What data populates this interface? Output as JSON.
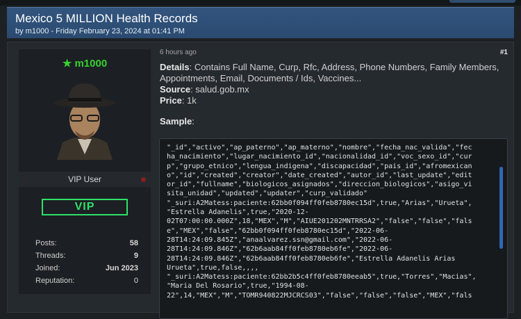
{
  "thread": {
    "title": "Mexico 5 MILLION Health Records",
    "byline": "by m1000 - Friday February 23, 2024 at 01:41 PM"
  },
  "author": {
    "username": "m1000",
    "role": "VIP User",
    "badge": "VIP",
    "stats": [
      {
        "label": "Posts:",
        "value": "58"
      },
      {
        "label": "Threads:",
        "value": "9"
      },
      {
        "label": "Joined:",
        "value": "Jun 2023"
      },
      {
        "label": "Reputation:",
        "value": "0"
      }
    ]
  },
  "post": {
    "time": "6 hours ago",
    "number": "#1",
    "details_label": "Details",
    "details_text": ": Contains Full Name, Curp, Rfc, Address, Phone Numbers, Family Members, Appointments, Email, Documents / Ids, Vaccines...",
    "source_label": "Source",
    "source_text": ": salud.gob.mx",
    "price_label": "Price",
    "price_text": ": 1k",
    "sample_label": "Sample",
    "sample_colon": ":",
    "code_lines": [
      "\"_id\",\"activo\",\"ap_paterno\",\"ap_materno\",\"nombre\",\"fecha_nac_valida\",\"fec",
      "ha_nacimiento\",\"lugar_nacimiento_id\",\"nacionalidad_id\",\"voc_sexo_id\",\"cur",
      "p\",\"grupo_etnico\",\"lengua_indigena\",\"discapacidad\",\"pais_id\",\"afromexican",
      "o\",\"id\",\"created\",\"creator\",\"date_created\",\"autor_id\",\"last_update\",\"edit",
      "or_id\",\"fullname\",\"biologicos_asignados\",\"direccion_biologicos\",\"asigo_vi",
      "sita_unidad\",\"updated\",\"updater\",\"curp_validado\"",
      "\"_suri:A2Matess:paciente:62bb0f094ff0feb8780ec15d\",true,\"Arias\",\"Urueta\",",
      "\"Estrella Adanelis\",true,\"2020-12-",
      "02T07:00:00.000Z\",18,\"MEX\",\"M\",\"AIUE201202MNTRRSA2\",\"false\",\"false\",\"fals",
      "e\",\"MEX\",\"false\",\"62bb0f094ff0feb8780ec15d\",\"2022-06-",
      "28T14:24:09.845Z\",\"anaalvarez.ssn@gmail.com\",\"2022-06-",
      "28T14:24:09.846Z\",\"62b6aab84ff0feb8780eb6fe\",\"2022-06-",
      "28T14:24:09.846Z\",\"62b6aab84ff0feb8780eb6fe\",\"Estrella Adanelis Arias",
      "Urueta\",true,false,,,,",
      "\"_suri:A2Matess:paciente:62bb2b5c4ff0feb8780eeab5\",true,\"Torres\",\"Macias\",",
      "\"Maria Del Rosario\",true,\"1994-08-",
      "22\",14,\"MEX\",\"M\",\"TOMR940822MJCRCS03\",\"false\",\"false\",\"false\",\"MEX\",\"fals"
    ]
  }
}
